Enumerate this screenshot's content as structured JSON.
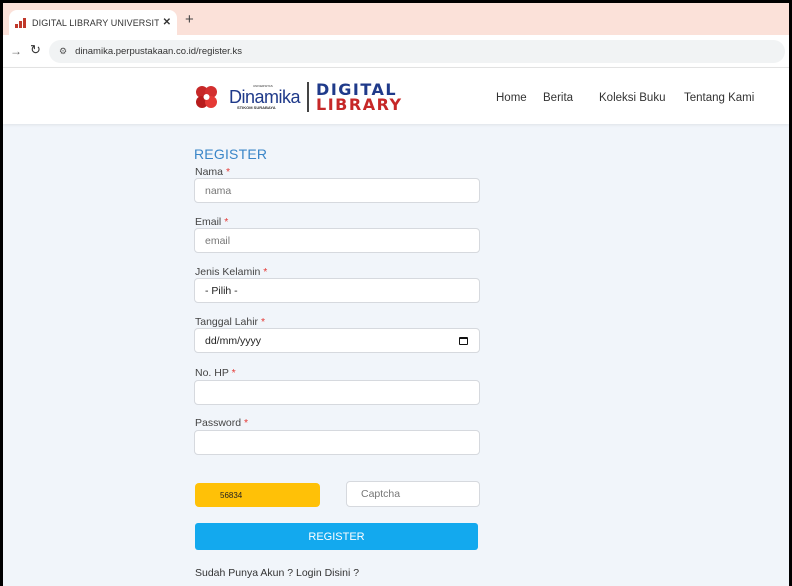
{
  "browser": {
    "tab_title": "DIGITAL LIBRARY UNIVERSITAS",
    "tab_close": "✕",
    "new_tab": "+",
    "url": "dinamika.perpustakaan.co.id/register.ks"
  },
  "header": {
    "logo": {
      "university": "UNIVERSITAS",
      "name": "Dinamika",
      "sub": "STIKOM SURABAYA",
      "digital": "DIGITAL",
      "library": "LIBRARY"
    },
    "nav": [
      {
        "label": "Home"
      },
      {
        "label": "Berita"
      },
      {
        "label": "Koleksi Buku"
      },
      {
        "label": "Tentang Kami"
      }
    ]
  },
  "form": {
    "title": "REGISTER",
    "required_mark": "*",
    "fields": {
      "nama": {
        "label": "Nama",
        "placeholder": "nama"
      },
      "email": {
        "label": "Email",
        "placeholder": "email"
      },
      "gender": {
        "label": "Jenis Kelamin",
        "selected": "- Pilih -"
      },
      "birthdate": {
        "label": "Tanggal Lahir",
        "value": "dd/mm/yyyy"
      },
      "phone": {
        "label": "No. HP",
        "value": ""
      },
      "password": {
        "label": "Password",
        "value": ""
      }
    },
    "captcha_code": "56834",
    "captcha_placeholder": "Captcha",
    "submit_label": "REGISTER",
    "login_text": "Sudah Punya Akun ? Login Disini ?"
  },
  "colors": {
    "accent": "#13a9ee",
    "title": "#3a86c8",
    "captcha": "#ffc107",
    "required": "#e53935"
  }
}
